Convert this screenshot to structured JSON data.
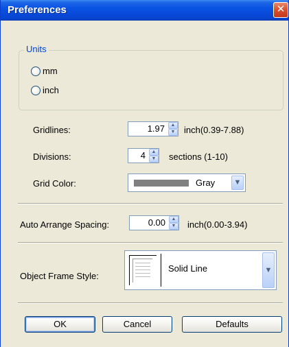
{
  "window": {
    "title": "Preferences",
    "close_symbol": "✕"
  },
  "units": {
    "legend": "Units",
    "options": [
      {
        "label": "mm",
        "selected": false
      },
      {
        "label": "inch",
        "selected": false
      }
    ]
  },
  "gridlines": {
    "label": "Gridlines:",
    "value": "1.97",
    "range": "inch(0.39-7.88)"
  },
  "divisions": {
    "label": "Divisions:",
    "value": "4",
    "range": "sections (1-10)"
  },
  "grid_color": {
    "label": "Grid Color:",
    "value": "Gray",
    "swatch": "#808080"
  },
  "auto_arrange": {
    "label": "Auto Arrange Spacing:",
    "value": "0.00",
    "range": "inch(0.00-3.94)"
  },
  "frame_style": {
    "label": "Object Frame Style:",
    "value": "Solid Line"
  },
  "buttons": {
    "ok": "OK",
    "cancel": "Cancel",
    "defaults": "Defaults"
  },
  "colors": {
    "title_bar": "#0a54e3",
    "dialog_bg": "#ece9d8",
    "legend_text": "#0046d5",
    "close_button": "#d8502c"
  }
}
